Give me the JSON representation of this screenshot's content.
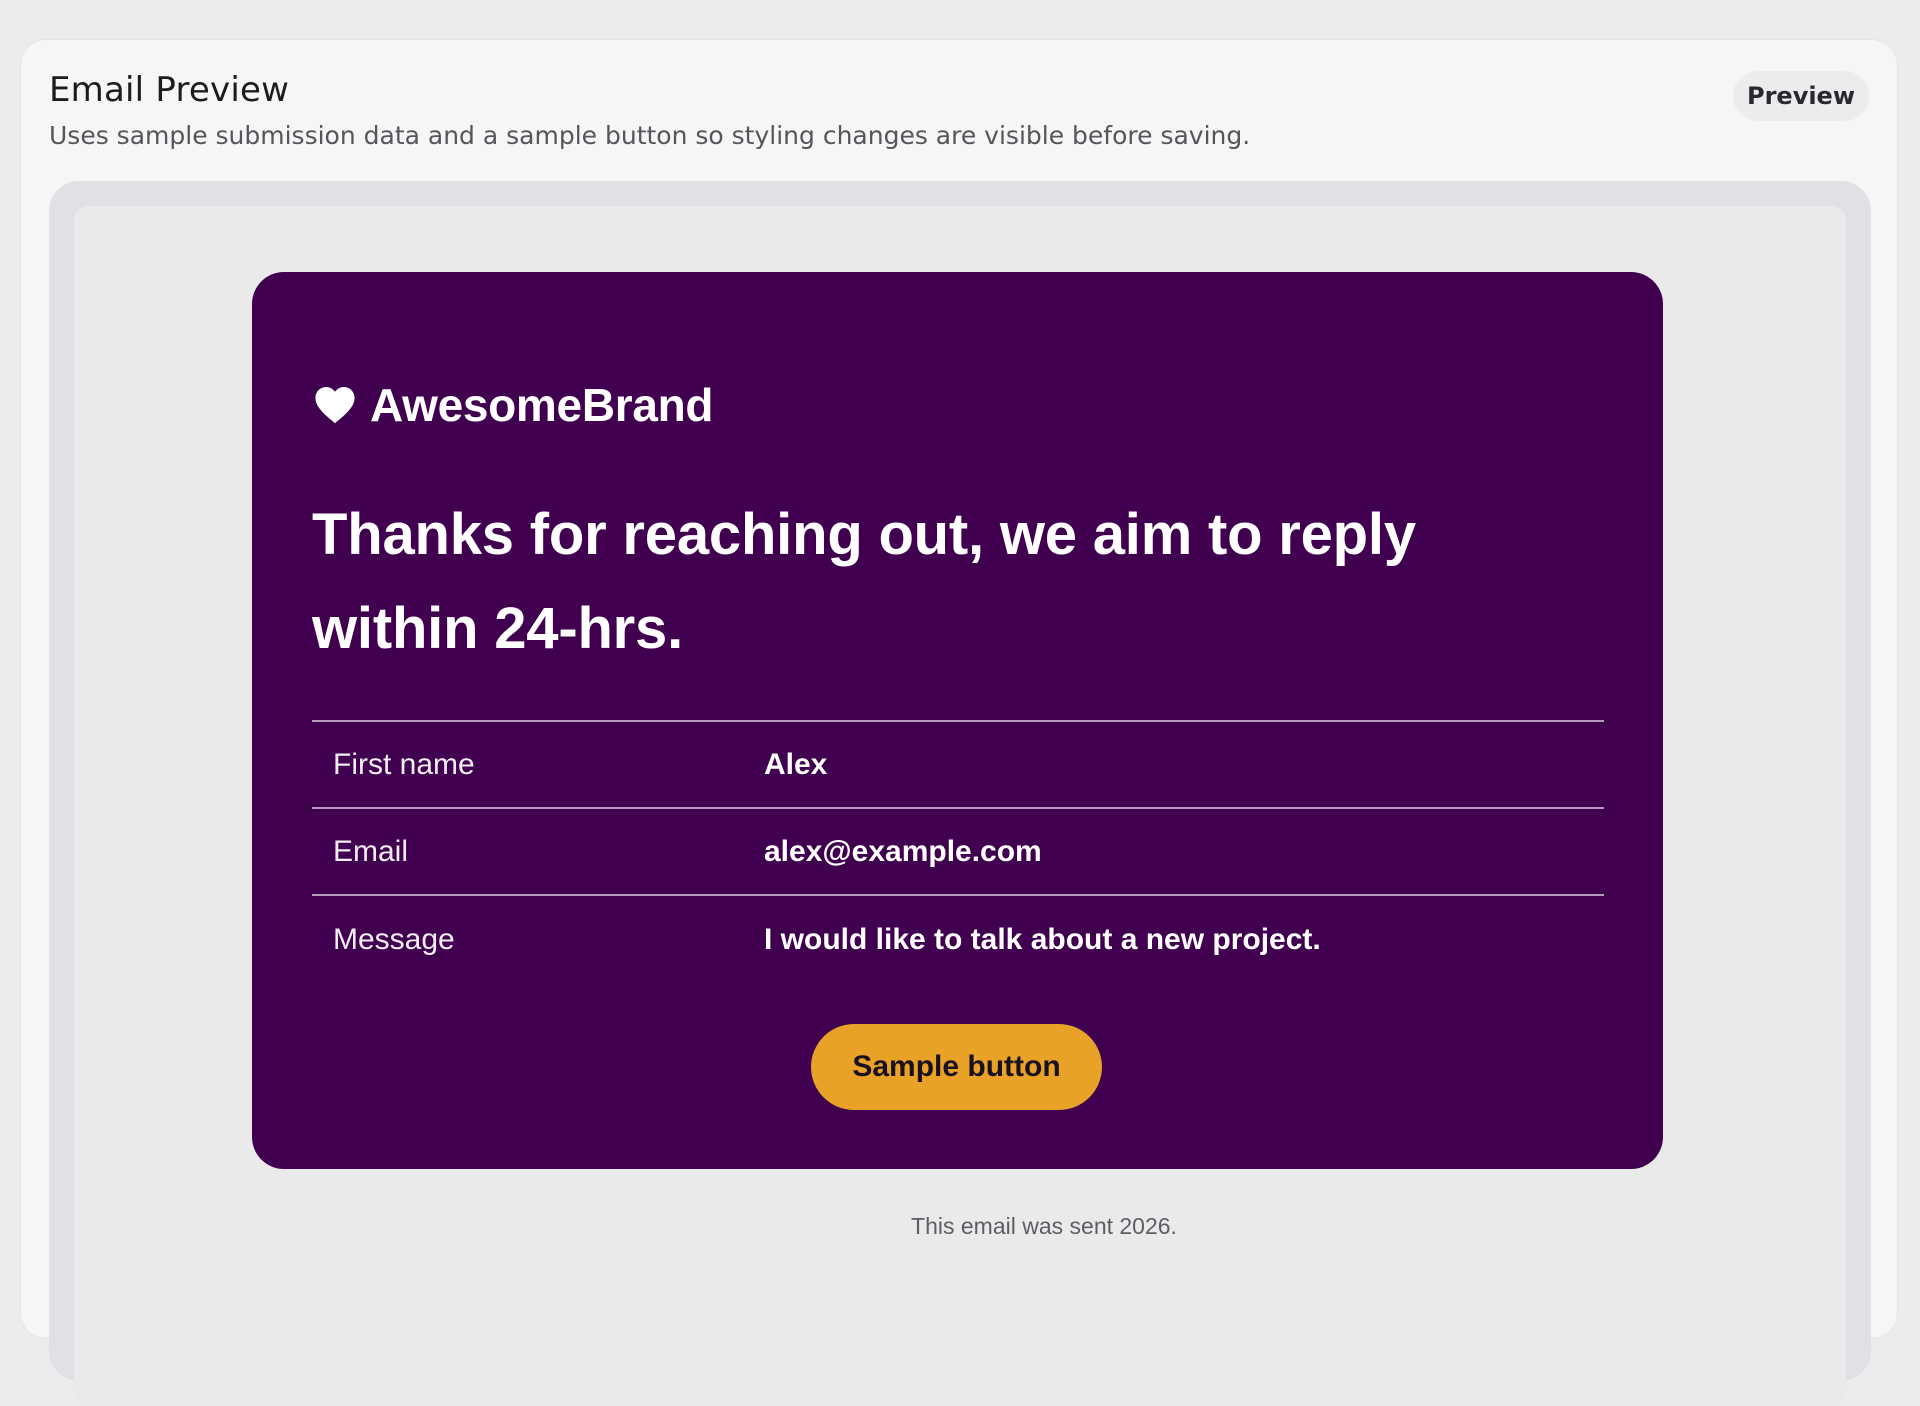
{
  "panel": {
    "title": "Email Preview",
    "subtitle": "Uses sample submission data and a sample button so styling changes are visible before saving.",
    "badge_label": "Preview"
  },
  "email": {
    "brand_icon": "heart-icon",
    "brand_name": "AwesomeBrand",
    "headline": "Thanks for reaching out, we aim to reply within 24-hrs.",
    "fields": [
      {
        "label": "First name",
        "value": "Alex"
      },
      {
        "label": "Email",
        "value": "alex@example.com"
      },
      {
        "label": "Message",
        "value": "I would like to talk about a new project."
      }
    ],
    "button_label": "Sample button",
    "footer": "This email was sent  2026."
  },
  "colors": {
    "email_background": "#41004f",
    "button_background": "#e8a227",
    "divider": "#b79bbd",
    "text_on_email": "#ffffff"
  }
}
